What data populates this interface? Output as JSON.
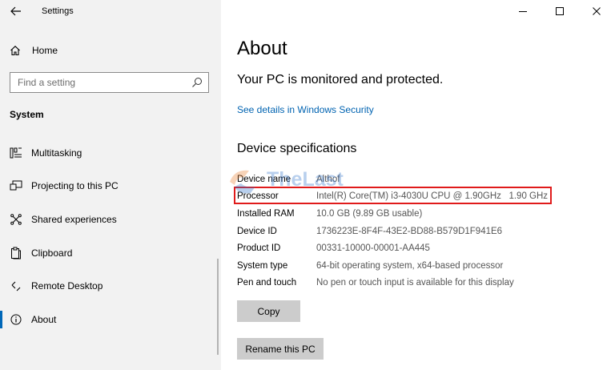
{
  "window": {
    "title": "Settings",
    "controls": [
      "minimize",
      "maximize",
      "close"
    ]
  },
  "sidebar": {
    "home_label": "Home",
    "search_placeholder": "Find a setting",
    "section_label": "System",
    "items": [
      {
        "label": "Multitasking",
        "icon": "multitasking-icon"
      },
      {
        "label": "Projecting to this PC",
        "icon": "projecting-icon"
      },
      {
        "label": "Shared experiences",
        "icon": "shared-experiences-icon"
      },
      {
        "label": "Clipboard",
        "icon": "clipboard-icon"
      },
      {
        "label": "Remote Desktop",
        "icon": "remote-desktop-icon"
      },
      {
        "label": "About",
        "icon": "info-icon",
        "active": true
      }
    ]
  },
  "main": {
    "title": "About",
    "protection_message": "Your PC is monitored and protected.",
    "security_link": "See details in Windows Security",
    "spec_heading": "Device specifications",
    "specs": [
      {
        "key": "Device name",
        "value": "Althof"
      },
      {
        "key": "Processor",
        "value": "Intel(R) Core(TM) i3-4030U CPU @ 1.90GHz   1.90 GHz"
      },
      {
        "key": "Installed RAM",
        "value": "10.0 GB (9.89 GB usable)"
      },
      {
        "key": "Device ID",
        "value": "1736223E-8F4F-43E2-BD88-B579D1F941E6"
      },
      {
        "key": "Product ID",
        "value": "00331-10000-00001-AA445"
      },
      {
        "key": "System type",
        "value": "64-bit operating system, x64-based processor"
      },
      {
        "key": "Pen and touch",
        "value": "No pen or touch input is available for this display"
      }
    ],
    "copy_label": "Copy",
    "rename_label": "Rename this PC"
  },
  "watermark": {
    "text": "TheLast"
  },
  "colors": {
    "sidebar_bg": "#f2f2f2",
    "accent": "#0067b8",
    "link": "#0063b1",
    "highlight": "#e01b1b",
    "button_bg": "#cccccc"
  }
}
